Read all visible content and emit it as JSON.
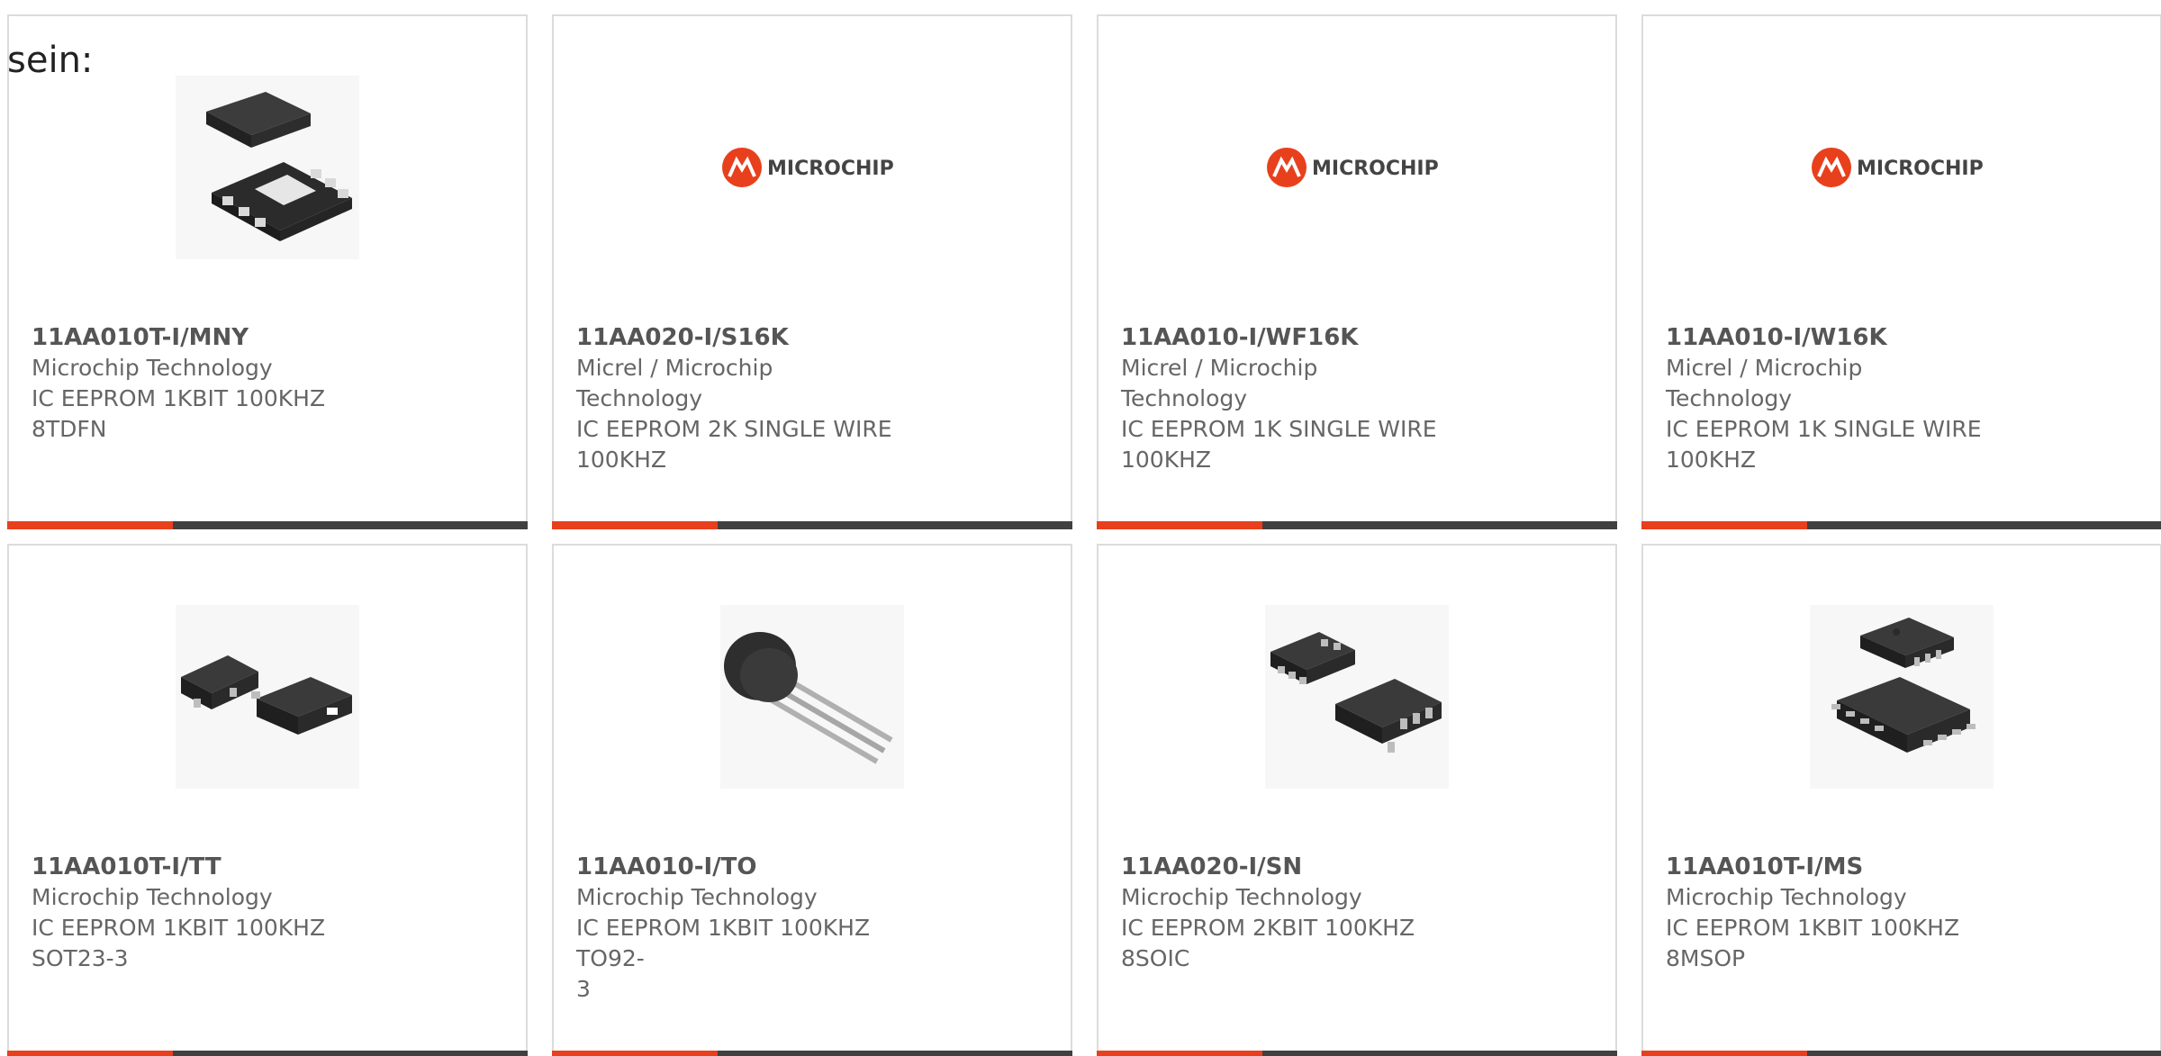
{
  "intro_text": "sein:",
  "colors": {
    "accent": "#e8401c",
    "bar_dark": "#404040",
    "chip_body": "#2b2b2b",
    "logo_red": "#e8401c"
  },
  "products": [
    {
      "part": "11AA010T-I/MNY",
      "maker": "Microchip Technology",
      "desc_line1": "IC EEPROM 1KBIT 100KHZ",
      "desc_line2": "8TDFN",
      "image": "tdfn-package-icon"
    },
    {
      "part": "11AA020-I/S16K",
      "maker": "Micrel / Microchip Technology",
      "desc_line1": "IC EEPROM 2K SINGLE WIRE",
      "desc_line2": "100KHZ",
      "image": "microchip-logo",
      "logo_text": "MICROCHIP"
    },
    {
      "part": "11AA010-I/WF16K",
      "maker": "Micrel / Microchip Technology",
      "desc_line1": "IC EEPROM 1K SINGLE WIRE",
      "desc_line2": "100KHZ",
      "image": "microchip-logo",
      "logo_text": "MICROCHIP"
    },
    {
      "part": "11AA010-I/W16K",
      "maker": "Micrel / Microchip Technology",
      "desc_line1": "IC EEPROM 1K SINGLE WIRE",
      "desc_line2": "100KHZ",
      "image": "microchip-logo",
      "logo_text": "MICROCHIP"
    },
    {
      "part": "11AA010T-I/TT",
      "maker": "Microchip Technology",
      "desc_line1": "IC EEPROM 1KBIT 100KHZ",
      "desc_line2": "SOT23-3",
      "image": "sot23-package-icon"
    },
    {
      "part": "11AA010-I/TO",
      "maker": "Microchip Technology",
      "desc_line1": "IC EEPROM 1KBIT 100KHZ TO92-",
      "desc_line2": "3",
      "image": "to92-package-icon"
    },
    {
      "part": "11AA020-I/SN",
      "maker": "Microchip Technology",
      "desc_line1": "IC EEPROM 2KBIT 100KHZ 8SOIC",
      "desc_line2": "",
      "image": "soic-package-icon"
    },
    {
      "part": "11AA010T-I/MS",
      "maker": "Microchip Technology",
      "desc_line1": "IC EEPROM 1KBIT 100KHZ",
      "desc_line2": "8MSOP",
      "image": "msop-package-icon"
    }
  ]
}
